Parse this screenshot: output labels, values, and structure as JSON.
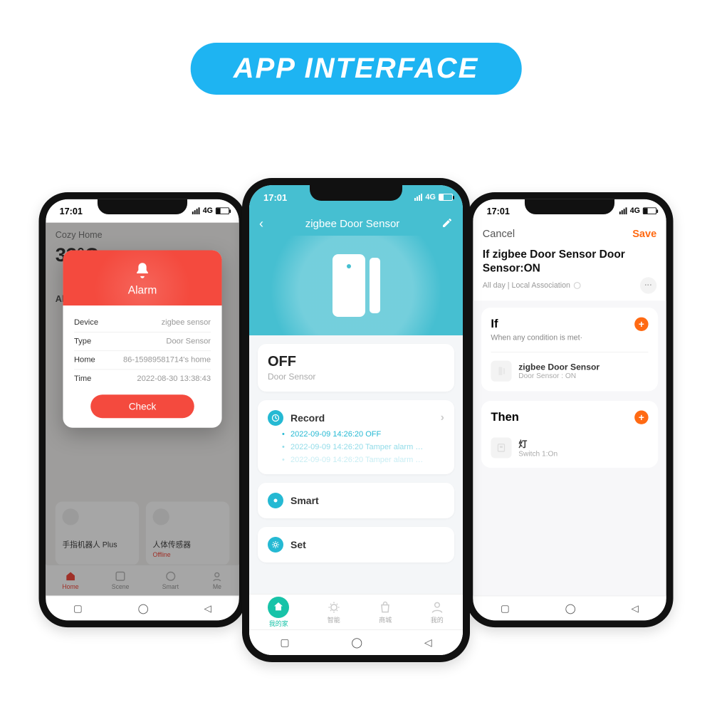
{
  "banner": "APP INTERFACE",
  "status": {
    "time": "17:01",
    "net": "4G"
  },
  "colors": {
    "accent_blue": "#1eb4f2",
    "teal": "#46bfd1",
    "green": "#18c3a8",
    "red": "#f44a3e",
    "orange": "#ff6a13"
  },
  "phone1": {
    "bg": {
      "home_label": "Cozy Home",
      "temp": "33°C",
      "tab_all": "All",
      "dev1": "手指机器人 Plus",
      "dev2": "人体传感器",
      "dev2_status": "Offline",
      "nav": [
        "Home",
        "Scene",
        "Smart",
        "Me"
      ]
    },
    "alarm": {
      "title": "Alarm",
      "rows": [
        {
          "k": "Device",
          "v": "zigbee sensor"
        },
        {
          "k": "Type",
          "v": "Door Sensor"
        },
        {
          "k": "Home",
          "v": "86-15989581714's home"
        },
        {
          "k": "Time",
          "v": "2022-08-30 13:38:43"
        }
      ],
      "check": "Check"
    }
  },
  "phone2": {
    "title": "zigbee Door Sensor",
    "state": "OFF",
    "state_sub": "Door Sensor",
    "record_label": "Record",
    "records": [
      "2022-09-09 14:26:20 OFF",
      "2022-09-09 14:26:20 Tamper alarm …",
      "2022-09-09 14:26:20 Tamper alarm …"
    ],
    "smart_label": "Smart",
    "set_label": "Set",
    "nav": [
      "我的家",
      "智能",
      "商城",
      "我的"
    ]
  },
  "phone3": {
    "cancel": "Cancel",
    "save": "Save",
    "title": "If zigbee Door Sensor Door Sensor:ON",
    "subtitle": "All day | Local Association",
    "if": {
      "heading": "If",
      "sub": "When any condition is met·",
      "item_title": "zigbee Door Sensor",
      "item_sub": "Door Sensor : ON"
    },
    "then": {
      "heading": "Then",
      "item_title": "灯",
      "item_sub": "Switch 1:On"
    }
  }
}
